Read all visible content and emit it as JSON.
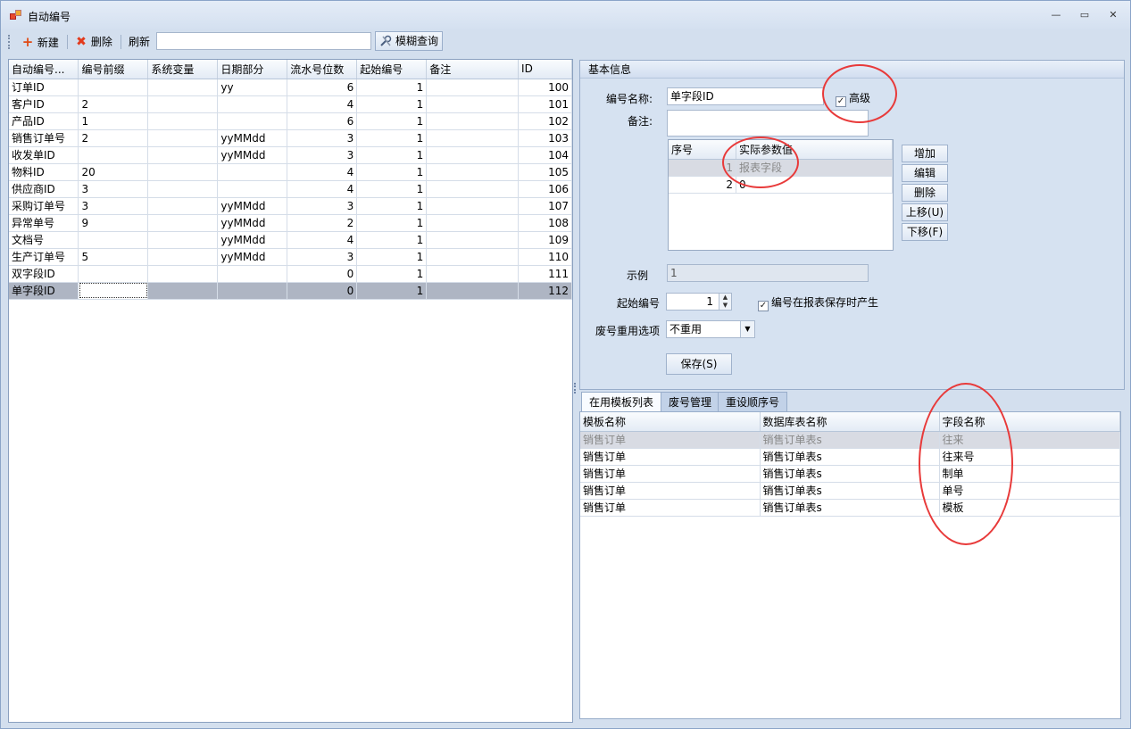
{
  "window": {
    "title": "自动编号",
    "minimize": "—",
    "restore": "▭",
    "close": "✕"
  },
  "toolbar": {
    "new_label": "新建",
    "delete_label": "删除",
    "refresh_label": "刷新",
    "search_value": "",
    "fuzzy_query_label": "模糊查询"
  },
  "left_grid": {
    "columns": [
      "自动编号...",
      "编号前缀",
      "系统变量",
      "日期部分",
      "流水号位数",
      "起始编号",
      "备注",
      "ID"
    ],
    "rows": [
      [
        "订单ID",
        "",
        "",
        "yy",
        "6",
        "1",
        "",
        "100"
      ],
      [
        "客户ID",
        "2",
        "",
        "",
        "4",
        "1",
        "",
        "101"
      ],
      [
        "产品ID",
        "1",
        "",
        "",
        "6",
        "1",
        "",
        "102"
      ],
      [
        "销售订单号",
        "2",
        "",
        "yyMMdd",
        "3",
        "1",
        "",
        "103"
      ],
      [
        "收发单ID",
        "",
        "",
        "yyMMdd",
        "3",
        "1",
        "",
        "104"
      ],
      [
        "物料ID",
        "20",
        "",
        "",
        "4",
        "1",
        "",
        "105"
      ],
      [
        "供应商ID",
        "3",
        "",
        "",
        "4",
        "1",
        "",
        "106"
      ],
      [
        "采购订单号",
        "3",
        "",
        "yyMMdd",
        "3",
        "1",
        "",
        "107"
      ],
      [
        "异常单号",
        "9",
        "",
        "yyMMdd",
        "2",
        "1",
        "",
        "108"
      ],
      [
        "文档号",
        "",
        "",
        "yyMMdd",
        "4",
        "1",
        "",
        "109"
      ],
      [
        "生产订单号",
        "5",
        "",
        "yyMMdd",
        "3",
        "1",
        "",
        "110"
      ],
      [
        "双字段ID",
        "",
        "",
        "",
        "0",
        "1",
        "",
        "111"
      ],
      [
        "单字段ID",
        "",
        "",
        "",
        "0",
        "1",
        "",
        "112"
      ]
    ],
    "selected_row": 12
  },
  "basic_info": {
    "group_title": "基本信息",
    "name_label": "编号名称:",
    "name_value": "单字段ID",
    "advanced_label": "高级",
    "advanced_checked": true,
    "remark_label": "备注:",
    "remark_value": "",
    "param_columns": [
      "序号",
      "实际参数值"
    ],
    "param_rows": [
      [
        "1",
        "报表字段"
      ],
      [
        "2",
        "0"
      ]
    ],
    "add_button": "增加",
    "edit_button": "编辑",
    "delete_button": "删除",
    "move_up_button": "上移(U)",
    "move_down_button": "下移(F)",
    "example_label": "示例",
    "example_value": "1",
    "start_label": "起始编号",
    "start_value": "1",
    "generate_on_save_label": "编号在报表保存时产生",
    "generate_on_save_checked": true,
    "reuse_label": "废号重用选项",
    "reuse_value": "不重用",
    "save_button": "保存(S)"
  },
  "tabs": {
    "items": [
      "在用模板列表",
      "废号管理",
      "重设顺序号"
    ],
    "active": 0
  },
  "template_grid": {
    "columns": [
      "模板名称",
      "数据库表名称",
      "字段名称"
    ],
    "rows": [
      [
        "销售订单",
        "销售订单表s",
        "往来"
      ],
      [
        "销售订单",
        "销售订单表s",
        "往来号"
      ],
      [
        "销售订单",
        "销售订单表s",
        "制单"
      ],
      [
        "销售订单",
        "销售订单表s",
        "单号"
      ],
      [
        "销售订单",
        "销售订单表s",
        "模板"
      ]
    ]
  },
  "colors": {
    "highlight_circle": "#e83a3a",
    "selected_row": "#aeb5c3",
    "add_icon": "#e04a14",
    "delete_icon": "#e33a1c"
  }
}
